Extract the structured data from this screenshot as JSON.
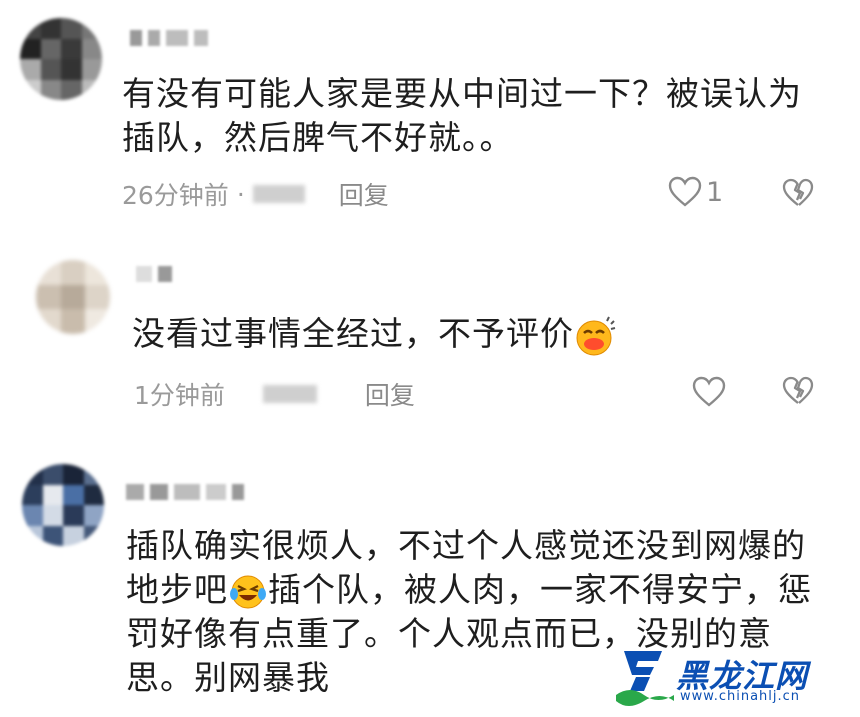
{
  "comments": [
    {
      "text_lines": [
        "有没有可能人家是要从中间过一下？被误认为",
        "插队，然后脾气不好就。。"
      ],
      "time": "26分钟前",
      "separator": "·",
      "reply": "回复",
      "likes": "1"
    },
    {
      "text_lines": [
        "没看过事情全经过，不予评价"
      ],
      "time": "1分钟前",
      "reply": "回复",
      "likes": ""
    },
    {
      "text_lines": [
        "插队确实很烦人，不过个人感觉还没到网爆的",
        "地步吧",
        "插个队，被人肉，一家不得安宁，惩",
        "罚好像有点重了。个人观点而已，没别的意",
        "思。别网暴我"
      ]
    }
  ],
  "watermark": {
    "name": "黑龙江网",
    "url": "www.chinahlj.cn"
  },
  "icons": {
    "like": "heart-outline-icon",
    "dislike": "broken-heart-icon",
    "emoji_1": "sweat-smile-emoji",
    "emoji_2": "laughing-tears-emoji"
  },
  "colors": {
    "text": "#1e1e1e",
    "meta": "#9a9a9a",
    "watermark_blue": "#0b4fb3",
    "watermark_green": "#2aa84a"
  }
}
